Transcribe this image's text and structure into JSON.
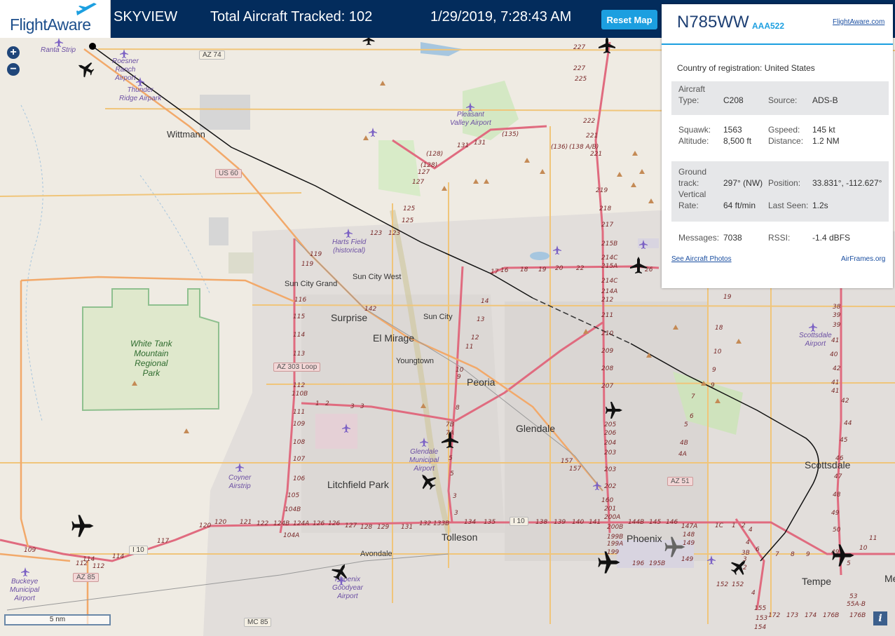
{
  "header": {
    "logo": "FlightAware",
    "app_name": "SKYVIEW",
    "total_tracked": "Total Aircraft Tracked: 102",
    "datetime": "1/29/2019, 7:28:43 AM",
    "reset_label": "Reset Map"
  },
  "panel": {
    "registration": "N785WW",
    "flight": "AAA522",
    "flightaware_link": "FlightAware.com",
    "country": "Country of registration: United States",
    "aircraft_type_label_1": "Aircraft",
    "aircraft_type_label_2": "Type:",
    "aircraft_type": "C208",
    "source_label": "Source:",
    "source": "ADS-B",
    "squawk_label": "Squawk:",
    "squawk": "1563",
    "gspeed_label": "Gspeed:",
    "gspeed": "145 kt",
    "altitude_label": "Altitude:",
    "altitude": "8,500 ft",
    "distance_label": "Distance:",
    "distance": "1.2 NM",
    "ground_label_1": "Ground",
    "ground_label_2": "track:",
    "ground_track": "297° (NW)",
    "position_label": "Position:",
    "position": "33.831°, -112.627°",
    "vertical_label_1": "Vertical",
    "vertical_label_2": "Rate:",
    "vertical_rate": "64 ft/min",
    "last_seen_label": "Last Seen:",
    "last_seen": "1.2s",
    "messages_label": "Messages:",
    "messages": "7038",
    "rssi_label": "RSSI:",
    "rssi": "-1.4 dBFS",
    "photos_link": "See Aircraft Photos",
    "airframes_link": "AirFrames.org"
  },
  "map": {
    "scale": "5 nm",
    "zoom_in": "+",
    "zoom_out": "−",
    "info": "i",
    "cities": {
      "wittmann": "Wittmann",
      "sun_city_grand": "Sun City Grand",
      "sun_city_west": "Sun City West",
      "surprise": "Surprise",
      "sun_city": "Sun City",
      "el_mirage": "El Mirage",
      "youngtown": "Youngtown",
      "peoria": "Peoria",
      "glendale": "Glendale",
      "litchfield_park": "Litchfield Park",
      "tolleson": "Tolleson",
      "avondale": "Avondale",
      "phoenix": "Phoenix",
      "scottsdale": "Scottsdale",
      "tempe": "Tempe",
      "me": "Me"
    },
    "airports": {
      "ranta": "Ranta Strip",
      "roesner_1": "Roesner",
      "roesner_2": "Ranch",
      "roesner_3": "Airport",
      "thunder_1": "Thunder",
      "thunder_2": "Ridge Airpark",
      "pleasant_1": "Pleasant",
      "pleasant_2": "Valley Airport",
      "harts_1": "Harts Field",
      "harts_2": "(historical)",
      "glendale_1": "Glendale",
      "glendale_2": "Municipal",
      "glendale_3": "Airport",
      "coyner_1": "Coyner",
      "coyner_2": "Airstrip",
      "buckeye_1": "Buckeye",
      "buckeye_2": "Municipal",
      "buckeye_3": "Airport",
      "goodyear_1": "Phoenix",
      "goodyear_2": "Goodyear",
      "goodyear_3": "Airport",
      "scottsdale_1": "Scottsdale",
      "scottsdale_2": "Airport"
    },
    "parks": {
      "white_tank_1": "White Tank",
      "white_tank_2": "Mountain",
      "white_tank_3": "Regional",
      "white_tank_4": "Park"
    },
    "routes": {
      "az74": "AZ 74",
      "us60": "US 60",
      "az303": "AZ 303 Loop",
      "az51": "AZ 51",
      "i10_east": "I 10",
      "i10_west": "I 10",
      "az85": "AZ 85",
      "mc85": "MC 85"
    }
  }
}
